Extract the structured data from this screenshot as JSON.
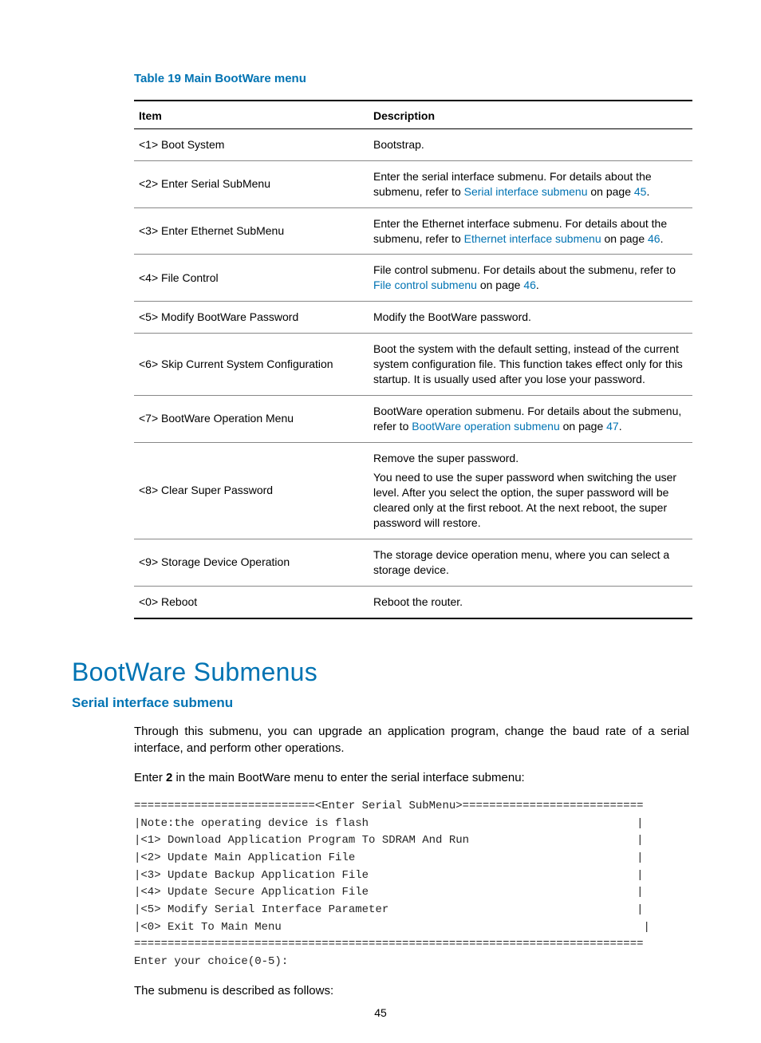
{
  "table": {
    "caption": "Table 19 Main BootWare menu",
    "headers": {
      "item": "Item",
      "desc": "Description"
    },
    "rows": [
      {
        "item": "<1> Boot System",
        "desc": [
          {
            "pre": "Bootstrap."
          }
        ]
      },
      {
        "item": "<2> Enter Serial SubMenu",
        "desc": [
          {
            "pre": "Enter the serial interface submenu. For details about the submenu, refer to ",
            "link": "Serial interface submenu",
            "post": " on page ",
            "page": "45",
            "tail": "."
          }
        ]
      },
      {
        "item": "<3> Enter Ethernet SubMenu",
        "desc": [
          {
            "pre": "Enter the Ethernet interface submenu. For details about the submenu, refer to ",
            "link": "Ethernet interface submenu",
            "post": " on page ",
            "page": "46",
            "tail": "."
          }
        ]
      },
      {
        "item": "<4> File Control",
        "desc": [
          {
            "pre": "File control submenu. For details about the submenu, refer to ",
            "link": "File control submenu",
            "post": " on page ",
            "page": "46",
            "tail": "."
          }
        ]
      },
      {
        "item": "<5> Modify BootWare Password",
        "desc": [
          {
            "pre": "Modify the BootWare password."
          }
        ]
      },
      {
        "item": "<6> Skip Current System Configuration",
        "desc": [
          {
            "pre": "Boot the system with the default setting, instead of the current system configuration file. This function takes effect only for this startup. It is usually used after you lose your password."
          }
        ]
      },
      {
        "item": "<7> BootWare Operation Menu",
        "desc": [
          {
            "pre": "BootWare operation submenu. For details about the submenu, refer to ",
            "link": "BootWare operation submenu",
            "post": " on page ",
            "page": "47",
            "tail": "."
          }
        ]
      },
      {
        "item": "<8> Clear Super Password",
        "desc": [
          {
            "pre": "Remove the super password."
          },
          {
            "pre": "You need to use the super password when switching the user level. After you select the option, the super password will be cleared only at the first reboot. At the next reboot, the super password will restore."
          }
        ]
      },
      {
        "item": "<9> Storage Device Operation",
        "desc": [
          {
            "pre": "The storage device operation menu, where you can select a storage device."
          }
        ]
      },
      {
        "item": "<0> Reboot",
        "desc": [
          {
            "pre": "Reboot the router."
          }
        ]
      }
    ]
  },
  "section": {
    "h1": "BootWare Submenus",
    "h2": "Serial interface submenu",
    "intro": "Through this submenu, you can upgrade an application program, change the baud rate of a serial interface, and perform other operations.",
    "enter_pre": "Enter ",
    "enter_bold": "2",
    "enter_post": " in the main BootWare menu to enter the serial interface submenu:",
    "followup": "The submenu is described as follows:"
  },
  "terminal": "===========================<Enter Serial SubMenu>===========================\n|Note:the operating device is flash                                        |\n|<1> Download Application Program To SDRAM And Run                         |\n|<2> Update Main Application File                                          |\n|<3> Update Backup Application File                                        |\n|<4> Update Secure Application File                                        |\n|<5> Modify Serial Interface Parameter                                     |\n|<0> Exit To Main Menu                                                      |\n============================================================================\nEnter your choice(0-5):",
  "page_number": "45"
}
